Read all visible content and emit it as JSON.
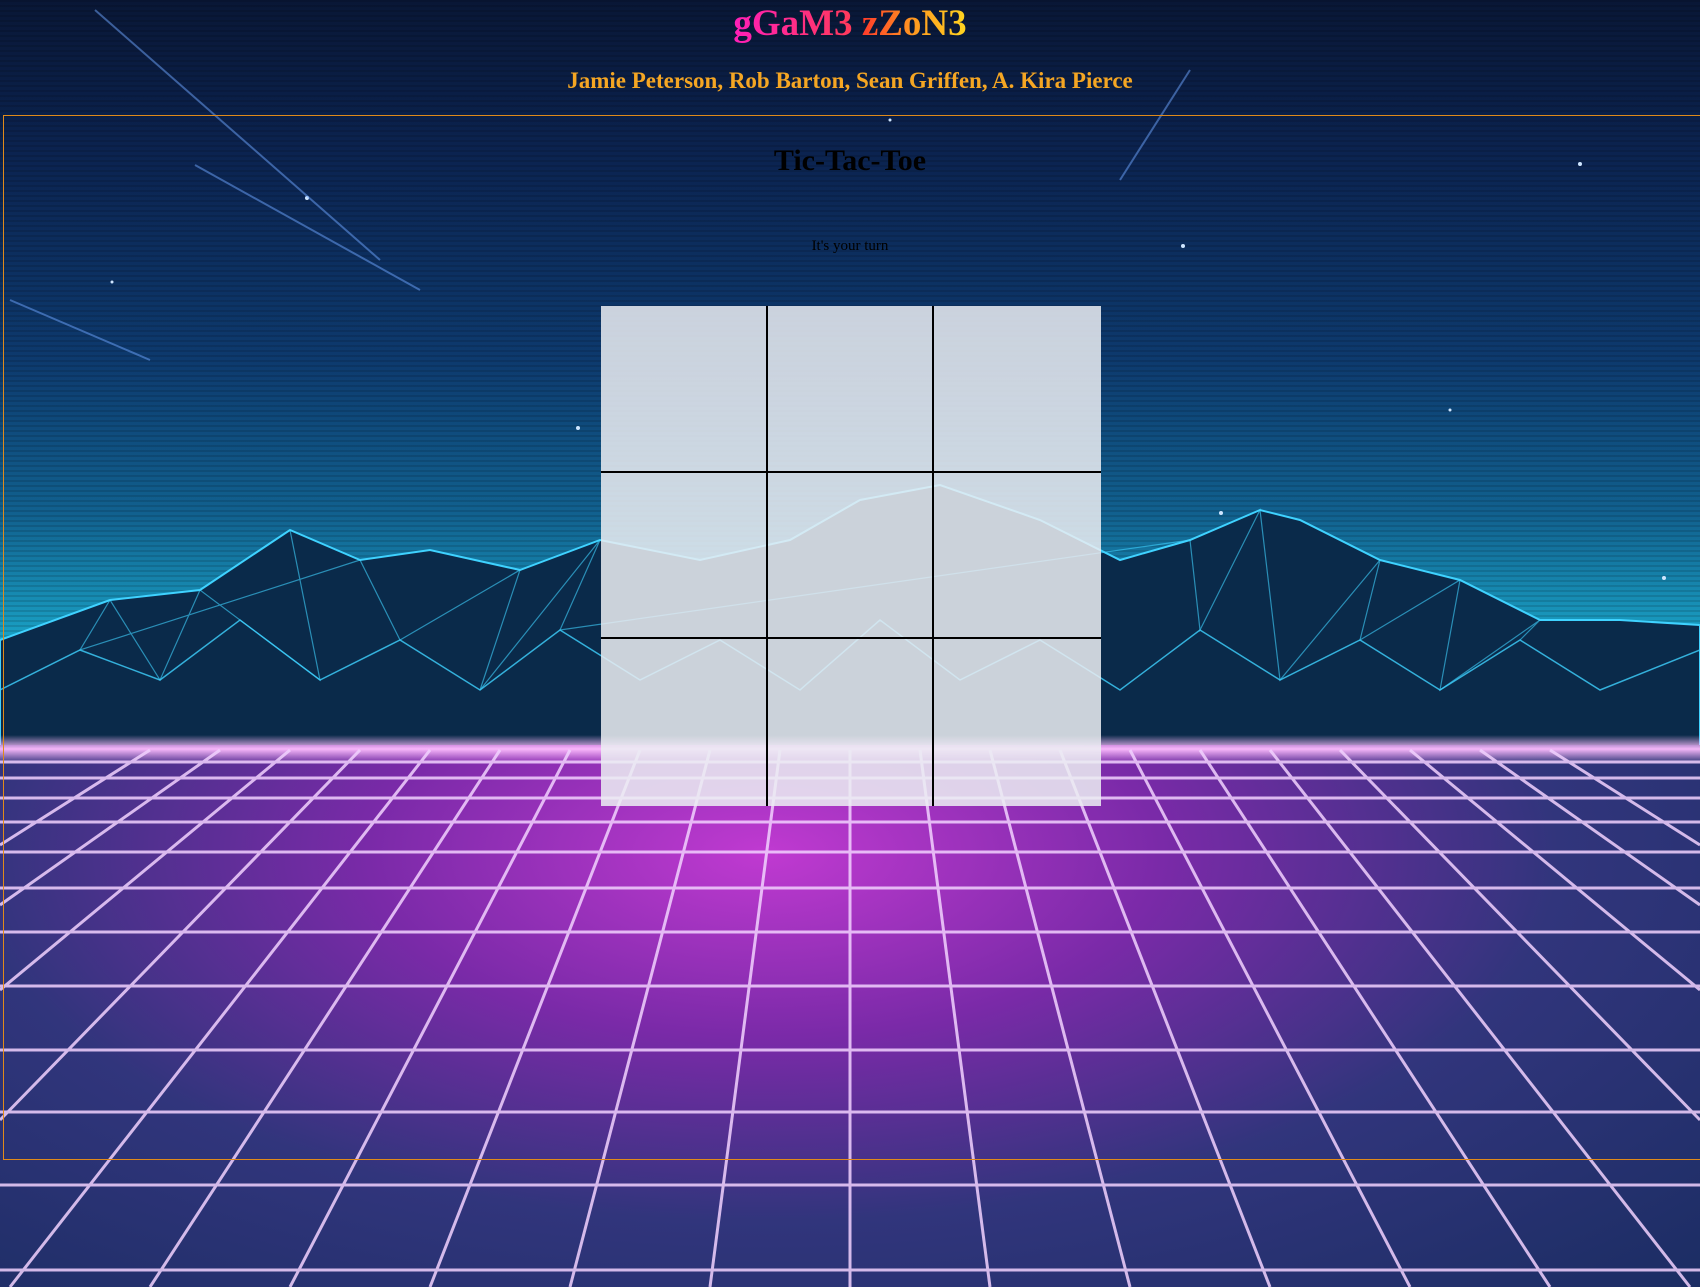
{
  "header": {
    "title_part1": "gGaM3",
    "title_part2": "zZoN3",
    "authors": "Jamie Peterson, Rob Barton, Sean Griffen, A. Kira Pierce"
  },
  "game": {
    "title": "Tic-Tac-Toe",
    "status": "It's your turn",
    "board": [
      "",
      "",
      "",
      "",
      "",
      "",
      "",
      "",
      ""
    ]
  },
  "colors": {
    "panel_border": "#e08a1a",
    "authors_text": "#f5a623",
    "cell_background": "#ebeef2"
  }
}
